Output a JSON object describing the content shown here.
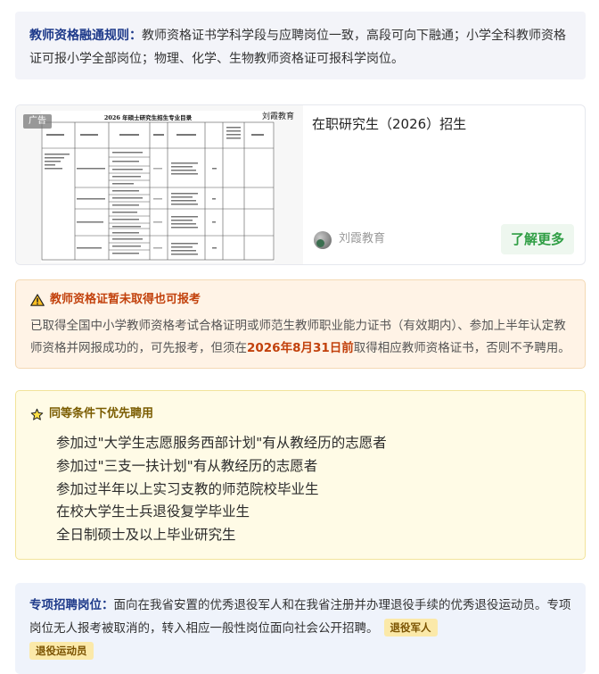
{
  "rule": {
    "label": "教师资格融通规则：",
    "text": "教师资格证书学科学段与应聘岗位一致，高段可向下融通；小学全科教师资格证可报小学全部岗位；物理、化学、生物教师资格证可报科学岗位。"
  },
  "ad": {
    "badge": "广告",
    "doc_title": "2026 年硕士研究生招生专业目录",
    "watermark": "刘霞教育",
    "title": "在职研究生（2026）招生",
    "author": "刘霞教育",
    "button": "了解更多"
  },
  "warning": {
    "icon": "warning-icon",
    "title": "教师资格证暂未取得也可报考",
    "text_before": "已取得全国中小学教师资格考试合格证明或师范生教师职业能力证书（有效期内）、参加上半年认定教师资格并网报成功的，可先报考，但须在",
    "deadline": "2026年8月31日前",
    "text_after": "取得相应教师资格证书，否则不予聘用。",
    "colors": {
      "accent": "#c2410c",
      "bg": "#fff3e6"
    }
  },
  "priority": {
    "icon": "star-icon",
    "title": "同等条件下优先聘用",
    "items": [
      "参加过\"大学生志愿服务西部计划\"有从教经历的志愿者",
      "参加过\"三支一扶计划\"有从教经历的志愿者",
      "参加过半年以上实习支教的师范院校毕业生",
      "在校大学生士兵退役复学毕业生",
      "全日制硕士及以上毕业研究生"
    ]
  },
  "special": {
    "label": "专项招聘岗位：",
    "text": "面向在我省安置的优秀退役军人和在我省注册并办理退役手续的优秀退役运动员。专项岗位无人报考被取消的，转入相应一般性岗位面向社会公开招聘。",
    "tags": [
      "退役军人",
      "退役运动员"
    ]
  }
}
